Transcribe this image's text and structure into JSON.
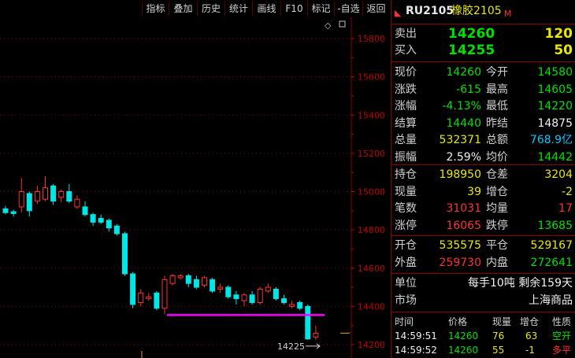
{
  "toolbar": {
    "items": [
      "指标",
      "叠加",
      "历史",
      "统计",
      "画线",
      "F10",
      "标记",
      "-自选",
      "返回"
    ]
  },
  "chart": {
    "y_ticks": [
      "15800",
      "15600",
      "15400",
      "15200",
      "15000",
      "14800",
      "14600",
      "14400",
      "14200"
    ],
    "y_values": [
      15800,
      15600,
      15400,
      15200,
      15000,
      14800,
      14600,
      14400,
      14200
    ],
    "low_label": "14225",
    "support_level": 14355,
    "candles": [
      {
        "o": 14910,
        "c": 14890,
        "h": 14925,
        "l": 14880
      },
      {
        "o": 14895,
        "c": 14885,
        "h": 14905,
        "l": 14870
      },
      {
        "o": 14920,
        "c": 15000,
        "h": 15070,
        "l": 14890
      },
      {
        "o": 14990,
        "c": 14900,
        "h": 15000,
        "l": 14870
      },
      {
        "o": 14950,
        "c": 15000,
        "h": 15030,
        "l": 14935
      },
      {
        "o": 14960,
        "c": 15020,
        "h": 15080,
        "l": 14950
      },
      {
        "o": 15030,
        "c": 14950,
        "h": 15040,
        "l": 14930
      },
      {
        "o": 14970,
        "c": 15000,
        "h": 15010,
        "l": 14945
      },
      {
        "o": 15000,
        "c": 14950,
        "h": 15040,
        "l": 14940
      },
      {
        "o": 14920,
        "c": 14960,
        "h": 14980,
        "l": 14910
      },
      {
        "o": 14920,
        "c": 14880,
        "h": 14950,
        "l": 14870
      },
      {
        "o": 14880,
        "c": 14840,
        "h": 14890,
        "l": 14820
      },
      {
        "o": 14860,
        "c": 14840,
        "h": 14880,
        "l": 14830
      },
      {
        "o": 14850,
        "c": 14810,
        "h": 14860,
        "l": 14790
      },
      {
        "o": 14820,
        "c": 14780,
        "h": 14830,
        "l": 14770
      },
      {
        "o": 14780,
        "c": 14570,
        "h": 14790,
        "l": 14560
      },
      {
        "o": 14570,
        "c": 14410,
        "h": 14580,
        "l": 14390
      },
      {
        "o": 14420,
        "c": 14470,
        "h": 14490,
        "l": 14400
      },
      {
        "o": 14440,
        "c": 14450,
        "h": 14470,
        "l": 14430
      },
      {
        "o": 14470,
        "c": 14390,
        "h": 14480,
        "l": 14380
      },
      {
        "o": 14390,
        "c": 14540,
        "h": 14560,
        "l": 14360
      },
      {
        "o": 14520,
        "c": 14560,
        "h": 14570,
        "l": 14510
      },
      {
        "o": 14550,
        "c": 14560,
        "h": 14570,
        "l": 14540
      },
      {
        "o": 14560,
        "c": 14520,
        "h": 14570,
        "l": 14500
      },
      {
        "o": 14540,
        "c": 14500,
        "h": 14560,
        "l": 14490
      },
      {
        "o": 14510,
        "c": 14550,
        "h": 14560,
        "l": 14500
      },
      {
        "o": 14540,
        "c": 14480,
        "h": 14550,
        "l": 14470
      },
      {
        "o": 14490,
        "c": 14500,
        "h": 14520,
        "l": 14470
      },
      {
        "o": 14500,
        "c": 14450,
        "h": 14510,
        "l": 14440
      },
      {
        "o": 14460,
        "c": 14440,
        "h": 14480,
        "l": 14410
      },
      {
        "o": 14430,
        "c": 14460,
        "h": 14470,
        "l": 14400
      },
      {
        "o": 14460,
        "c": 14420,
        "h": 14480,
        "l": 14410
      },
      {
        "o": 14420,
        "c": 14490,
        "h": 14500,
        "l": 14410
      },
      {
        "o": 14480,
        "c": 14500,
        "h": 14520,
        "l": 14470
      },
      {
        "o": 14490,
        "c": 14440,
        "h": 14500,
        "l": 14430
      },
      {
        "o": 14440,
        "c": 14420,
        "h": 14460,
        "l": 14410
      },
      {
        "o": 14400,
        "c": 14410,
        "h": 14430,
        "l": 14390
      },
      {
        "o": 14420,
        "c": 14390,
        "h": 14430,
        "l": 14380
      },
      {
        "o": 14400,
        "c": 14230,
        "h": 14410,
        "l": 14225
      },
      {
        "o": 14240,
        "c": 14260,
        "h": 14300,
        "l": 14225
      }
    ]
  },
  "panel": {
    "code": "RU2105",
    "name": "橡胶2105",
    "marker": "M",
    "sell_label": "卖出",
    "sell_price": "14260",
    "sell_vol": "120",
    "buy_label": "买入",
    "buy_price": "14255",
    "buy_vol": "50",
    "rows_a": [
      {
        "l1": "现价",
        "v1": "14260",
        "l2": "今开",
        "v2": "14580",
        "c1": "g",
        "c2": "g"
      },
      {
        "l1": "涨跌",
        "v1": "-615",
        "l2": "最高",
        "v2": "14605",
        "c1": "g",
        "c2": "g"
      },
      {
        "l1": "涨幅",
        "v1": "-4.13%",
        "l2": "最低",
        "v2": "14220",
        "c1": "g",
        "c2": "g"
      },
      {
        "l1": "结算",
        "v1": "14440",
        "l2": "昨结",
        "v2": "14875",
        "c1": "g",
        "c2": "w"
      },
      {
        "l1": "总量",
        "v1": "532371",
        "l2": "总额",
        "v2": "768.9亿",
        "c1": "y",
        "c2": "c"
      },
      {
        "l1": "振幅",
        "v1": "2.59%",
        "l2": "均价",
        "v2": "14442",
        "c1": "w",
        "c2": "g"
      }
    ],
    "rows_b": [
      {
        "l1": "持仓",
        "v1": "198950",
        "l2": "仓差",
        "v2": "3204",
        "c1": "y",
        "c2": "y"
      },
      {
        "l1": "现量",
        "v1": "39",
        "l2": "增仓",
        "v2": "-2",
        "c1": "y",
        "c2": "y"
      },
      {
        "l1": "笔数",
        "v1": "31031",
        "l2": "均量",
        "v2": "17",
        "c1": "r",
        "c2": "r"
      },
      {
        "l1": "涨停",
        "v1": "16065",
        "l2": "跌停",
        "v2": "13685",
        "c1": "r",
        "c2": "g"
      }
    ],
    "rows_c": [
      {
        "l1": "开仓",
        "v1": "535575",
        "l2": "平仓",
        "v2": "529167",
        "c1": "y",
        "c2": "y"
      },
      {
        "l1": "外盘",
        "v1": "259730",
        "l2": "内盘",
        "v2": "272641",
        "c1": "r",
        "c2": "g"
      }
    ],
    "unit_label": "单位",
    "unit_value": "每手10吨  剩余159天",
    "market_label": "市场",
    "market_value": "上海商品",
    "trade_headers": [
      "时间",
      "价格",
      "现量",
      "增仓",
      "性质"
    ],
    "trades": [
      {
        "time": "14:59:51",
        "price": "14260",
        "vol": "76",
        "oi": "63",
        "type": "空开",
        "tc": "g"
      },
      {
        "time": "14:59:52",
        "price": "14260",
        "vol": "55",
        "oi": "-1",
        "type": "多平",
        "tc": "r"
      }
    ]
  }
}
